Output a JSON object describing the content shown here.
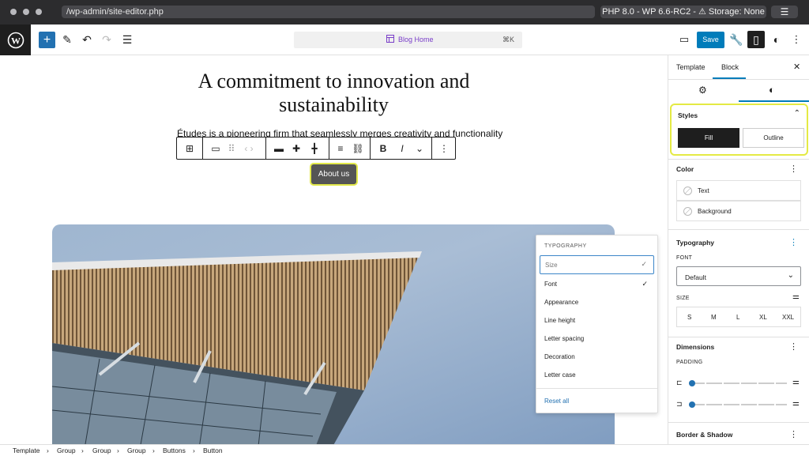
{
  "browser": {
    "url": "/wp-admin/site-editor.php",
    "env": "PHP 8.0 - WP 6.6-RC2 - ⚠ Storage: None"
  },
  "toolbar": {
    "command_label": "Blog Home",
    "command_shortcut": "⌘K",
    "save_label": "Save"
  },
  "canvas": {
    "heading": "A commitment to innovation and sustainability",
    "paragraph": "Études is a pioneering firm that seamlessly merges creativity and functionality",
    "button_label": "About us"
  },
  "typography_menu": {
    "header": "TYPOGRAPHY",
    "items": [
      "Size",
      "Font",
      "Appearance",
      "Line height",
      "Letter spacing",
      "Decoration",
      "Letter case"
    ],
    "reset": "Reset all"
  },
  "sidebar": {
    "tabs": [
      "Template",
      "Block"
    ],
    "styles": {
      "title": "Styles",
      "fill": "Fill",
      "outline": "Outline"
    },
    "color": {
      "title": "Color",
      "text": "Text",
      "background": "Background"
    },
    "typography": {
      "title": "Typography",
      "font_label": "FONT",
      "font_value": "Default",
      "size_label": "SIZE",
      "sizes": [
        "S",
        "M",
        "L",
        "XL",
        "XXL"
      ]
    },
    "dimensions": {
      "title": "Dimensions",
      "padding_label": "PADDING"
    },
    "border": {
      "title": "Border & Shadow"
    }
  },
  "breadcrumb": [
    "Template",
    "Group",
    "Group",
    "Group",
    "Buttons",
    "Button"
  ],
  "colors": {
    "accent": "#007cba",
    "highlight": "#e4ea44"
  }
}
